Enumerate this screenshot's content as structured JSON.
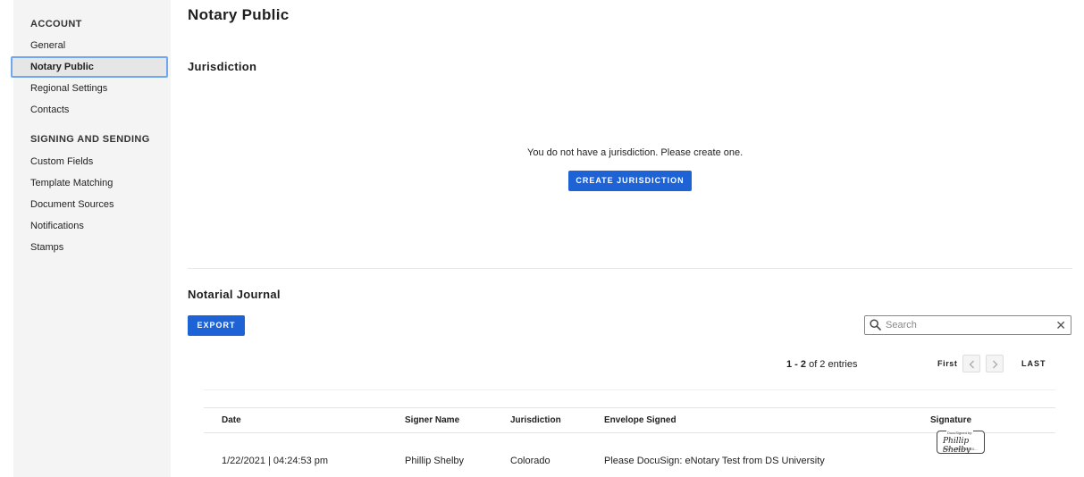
{
  "sidebar": {
    "sections": [
      {
        "heading": "ACCOUNT",
        "items": [
          "General",
          "Notary Public",
          "Regional Settings",
          "Contacts"
        ]
      },
      {
        "heading": "SIGNING AND SENDING",
        "items": [
          "Custom Fields",
          "Template Matching",
          "Document Sources",
          "Notifications",
          "Stamps"
        ]
      }
    ],
    "active_item": "Notary Public"
  },
  "page": {
    "title": "Notary Public"
  },
  "jurisdiction": {
    "title": "Jurisdiction",
    "empty_message": "You do not have a jurisdiction. Please create one.",
    "create_button": "CREATE JURISDICTION"
  },
  "journal": {
    "title": "Notarial Journal",
    "export_button": "EXPORT",
    "search": {
      "placeholder": "Search",
      "value": ""
    },
    "pagination": {
      "range": "1 - 2",
      "suffix": " of 2 entries",
      "first_label": "First",
      "last_label": "LAST"
    },
    "columns": {
      "date": "Date",
      "signer": "Signer Name",
      "jurisdiction": "Jurisdiction",
      "envelope": "Envelope Signed",
      "signature": "Signature"
    },
    "rows": [
      {
        "date": "1/22/2021 | 04:24:53 pm",
        "signer": "Phillip Shelby",
        "jurisdiction": "Colorado",
        "envelope": "Please DocuSign: eNotary Test from DS University",
        "signature": {
          "caption": "DocuSigned by:",
          "name": "Phillip Shelby",
          "code": "BA8F4A7BDC6D4B1..."
        }
      }
    ]
  },
  "colors": {
    "primary": "#1e63d6",
    "sidebar_bg": "#f4f4f4",
    "active_border": "#6fa8f0"
  }
}
